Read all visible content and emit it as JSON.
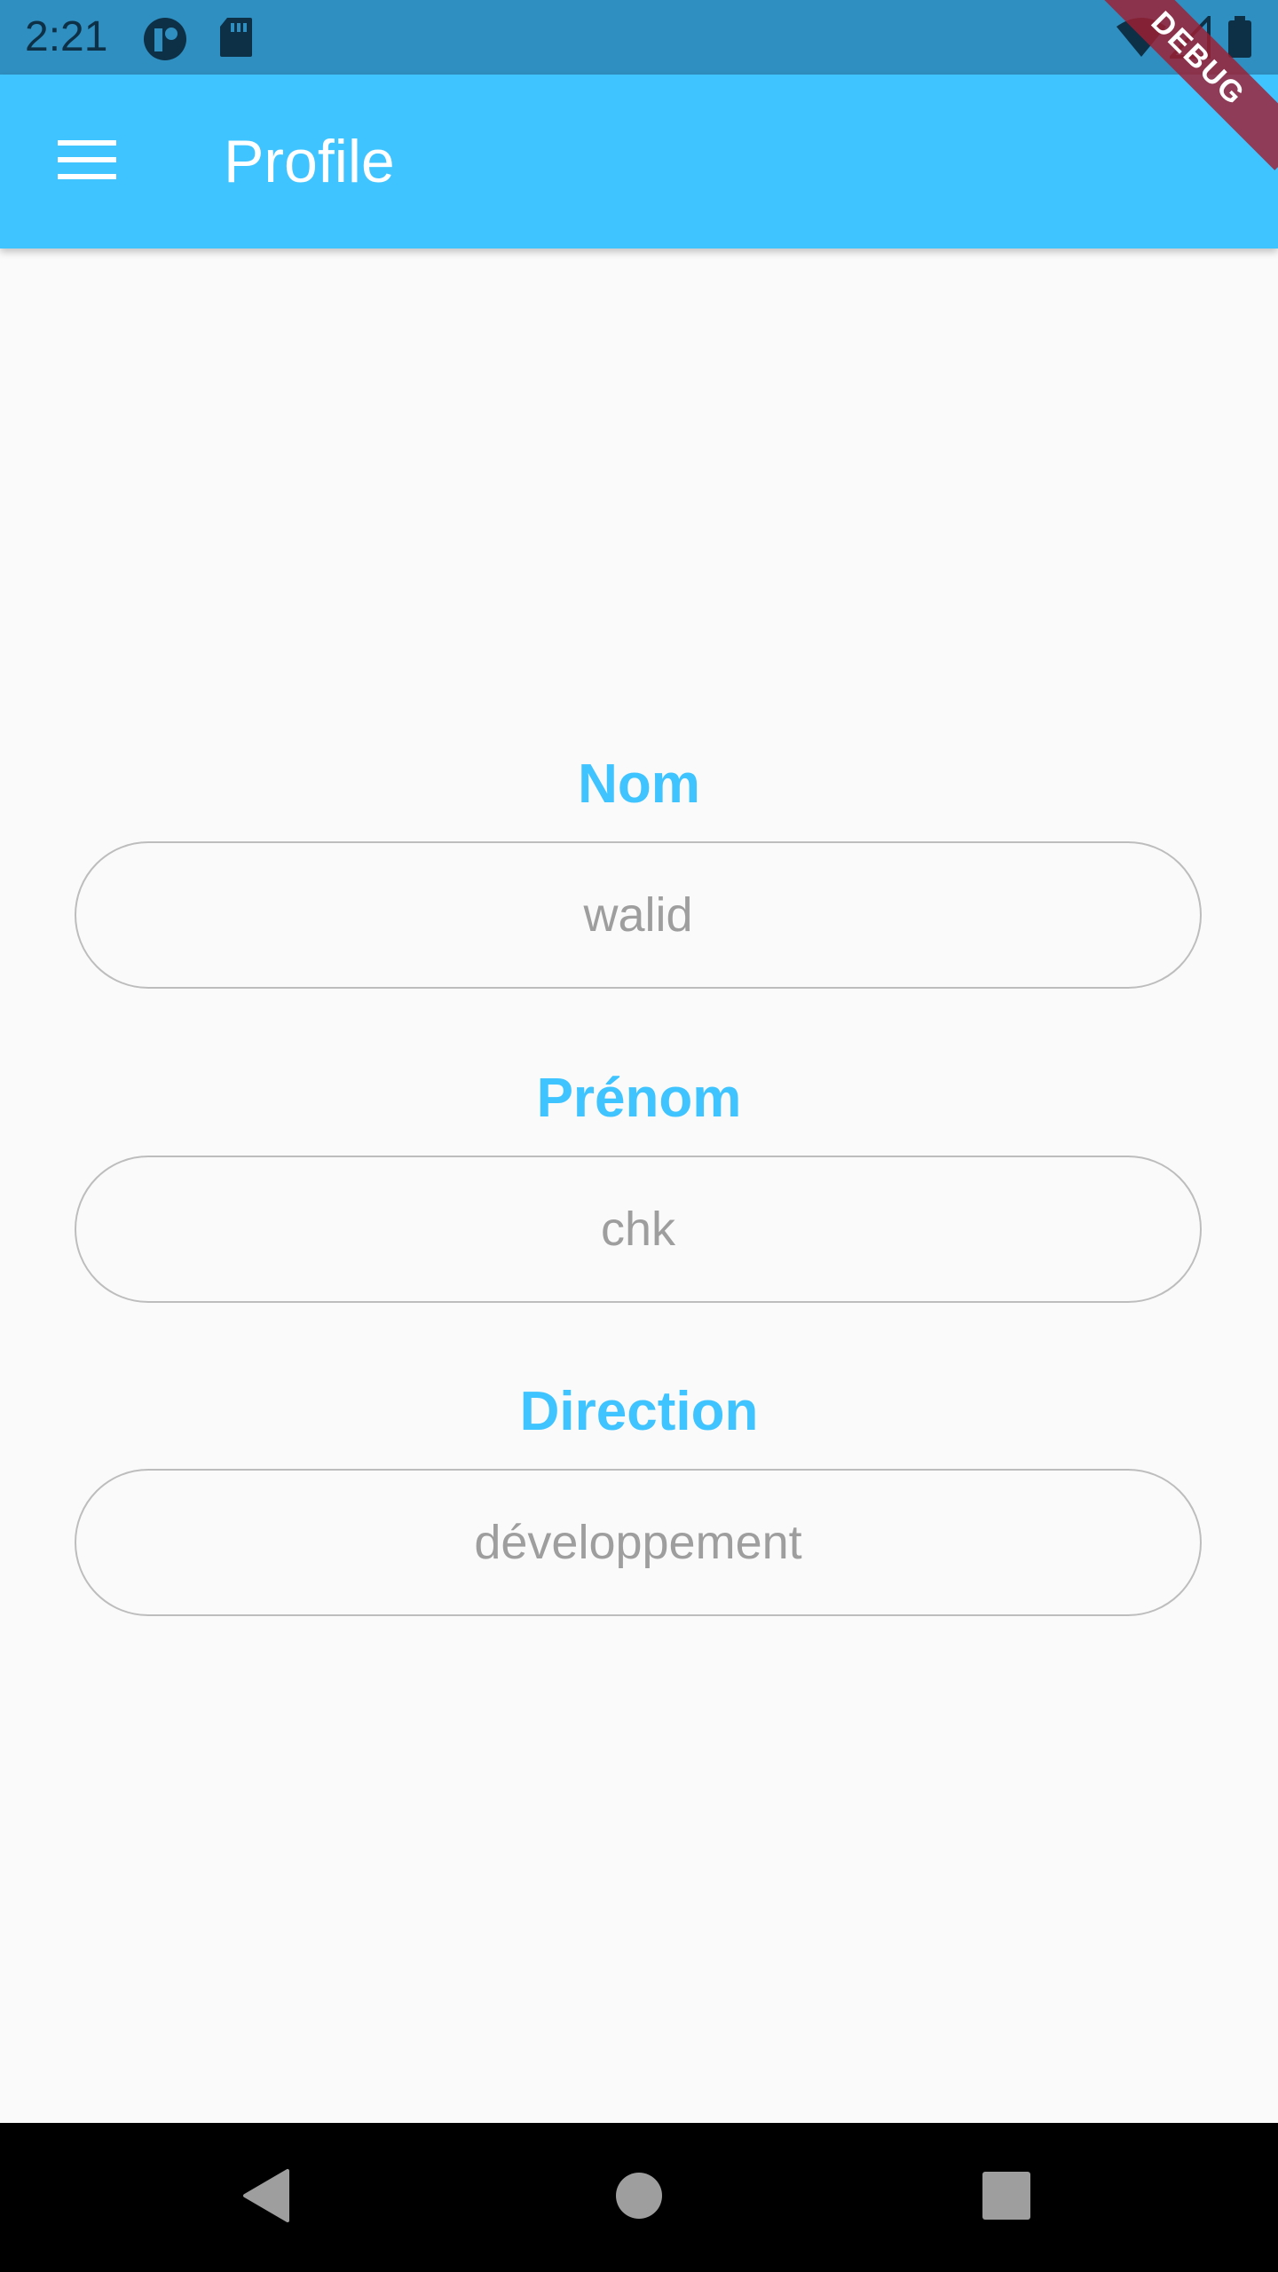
{
  "status_bar": {
    "time": "2:21",
    "icons": [
      "app-notification-icon",
      "sd-card-icon",
      "wifi-icon",
      "signal-icon",
      "battery-icon"
    ],
    "background": "#2F8FC0"
  },
  "app_bar": {
    "title": "Profile",
    "menu_icon": "hamburger-menu-icon",
    "background": "#40C4FF"
  },
  "debug_banner": {
    "label": "DEBUG"
  },
  "form": {
    "fields": [
      {
        "label": "Nom",
        "value": "walid"
      },
      {
        "label": "Prénom",
        "value": "chk"
      },
      {
        "label": "Direction",
        "value": "développement"
      }
    ],
    "label_color": "#40C4FF",
    "value_color": "#9E9E9E"
  },
  "nav_bar": {
    "buttons": [
      "back-icon",
      "home-icon",
      "recents-icon"
    ]
  }
}
